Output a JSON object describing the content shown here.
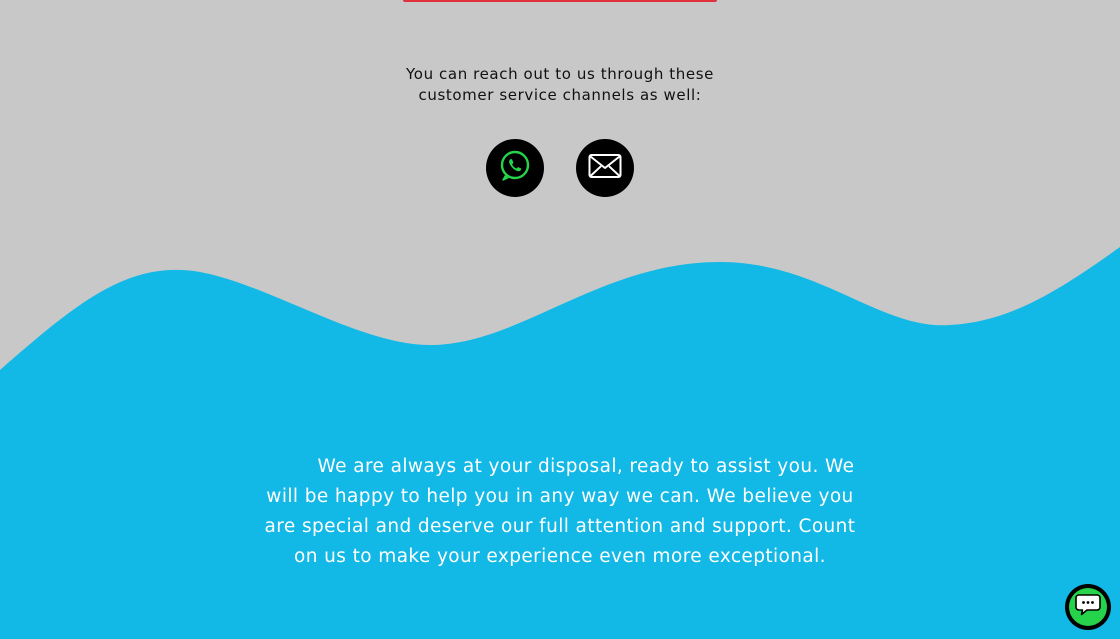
{
  "contact": {
    "intro_line1": "You can reach out to us through these",
    "intro_line2": "customer service channels as well:",
    "channels": [
      {
        "name": "WhatsApp",
        "icon": "whatsapp-icon"
      },
      {
        "name": "Email",
        "icon": "envelope-icon"
      }
    ]
  },
  "closing": {
    "text": "We are always at your disposal, ready to assist you. We will be happy to help you in any way we can. We believe you are special and deserve our full attention and support. Count on us to make your experience even more exceptional."
  },
  "chat_widget": {
    "icon": "chat-bubble-icon"
  },
  "colors": {
    "page_background": "#c8c8c8",
    "wave_blue": "#12b8e6",
    "accent_red": "#e0323c",
    "whatsapp_green": "#25d44a",
    "icon_background": "#000000",
    "text_dark": "#111111",
    "text_light": "#ffffff"
  }
}
